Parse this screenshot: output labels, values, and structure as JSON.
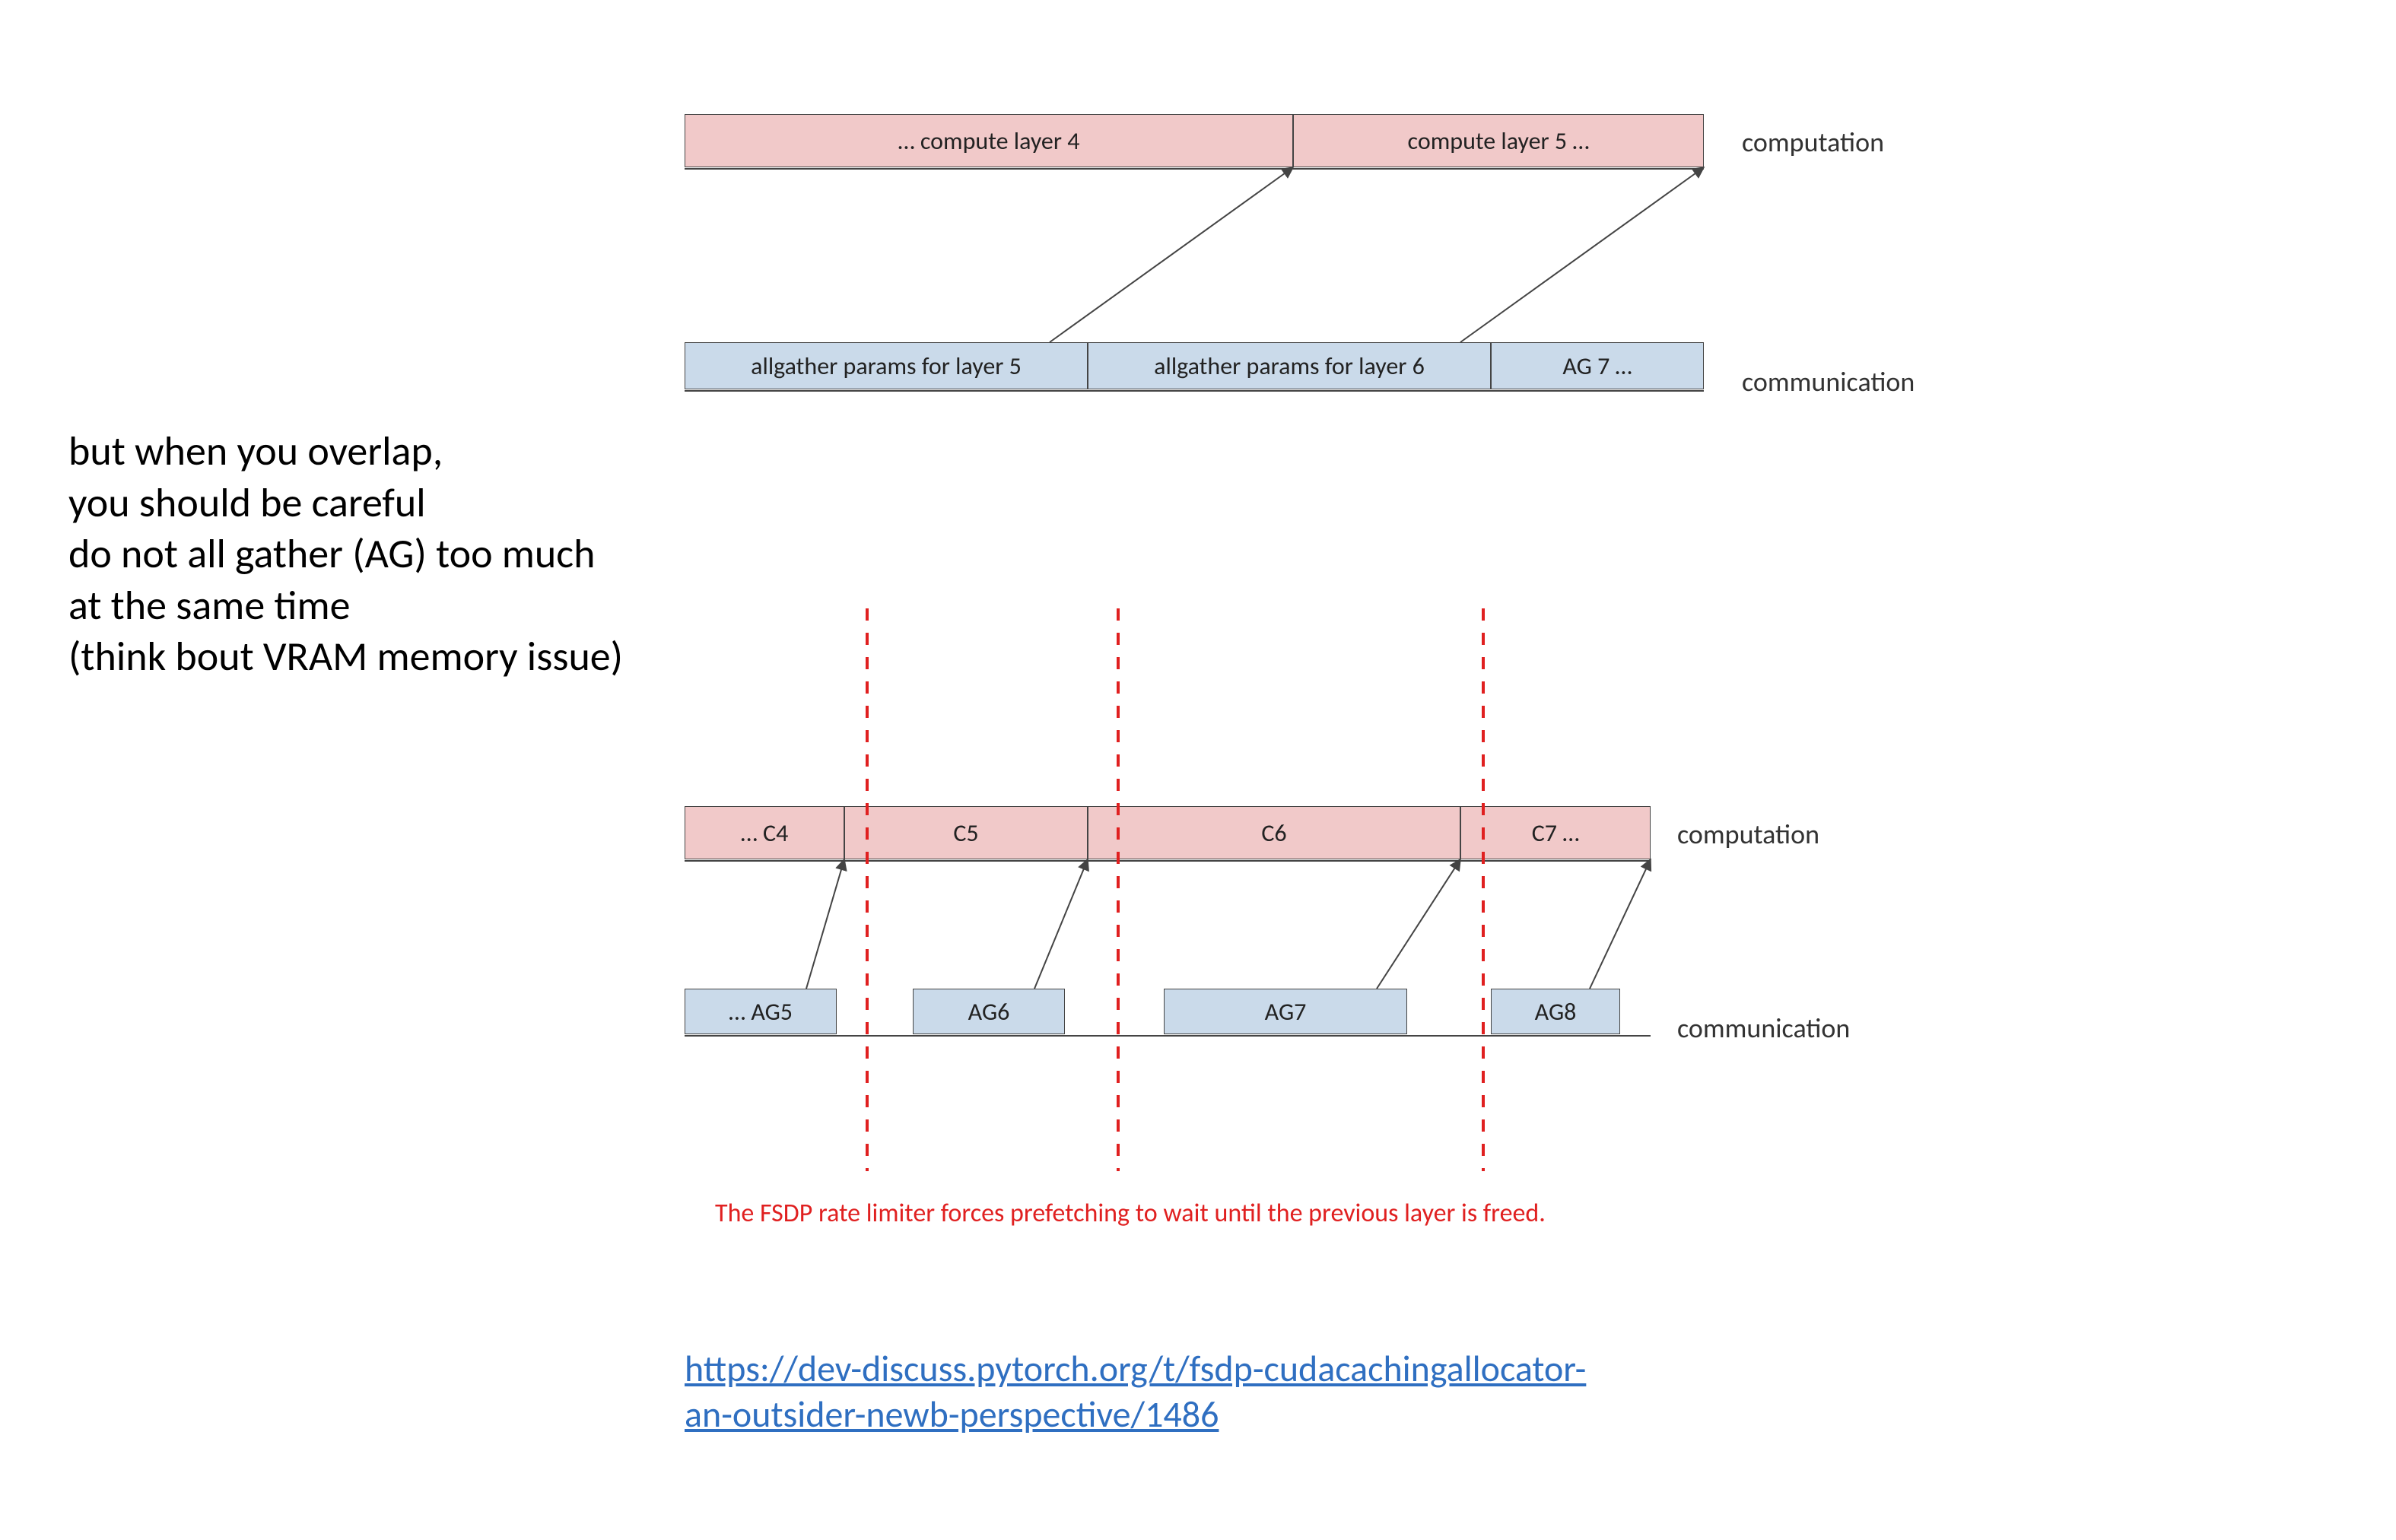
{
  "annotation": {
    "l1": "but when you overlap,",
    "l2": "you should be careful",
    "l3": "do not all gather (AG) too much",
    "l4": "at the same time",
    "l5": "(think bout VRAM memory issue)"
  },
  "diagram1": {
    "compute_row": {
      "items": [
        {
          "label": "… compute layer 4"
        },
        {
          "label": "compute layer 5 …"
        }
      ],
      "lane": "computation"
    },
    "comm_row": {
      "items": [
        {
          "label": "allgather params for layer 5"
        },
        {
          "label": "allgather params for layer 6"
        },
        {
          "label": "AG 7 …"
        }
      ],
      "lane": "communication"
    }
  },
  "diagram2": {
    "compute_row": {
      "items": [
        {
          "label": "… C4"
        },
        {
          "label": "C5"
        },
        {
          "label": "C6"
        },
        {
          "label": "C7 …"
        }
      ],
      "lane": "computation"
    },
    "comm_row": {
      "items": [
        {
          "label": "… AG5"
        },
        {
          "label": "AG6"
        },
        {
          "label": "AG7"
        },
        {
          "label": "AG8"
        }
      ],
      "lane": "communication"
    },
    "caption": "The FSDP rate limiter forces prefetching to wait until the previous layer is freed."
  },
  "link": {
    "l1": "https://dev-discuss.pytorch.org/t/fsdp-cudacachingallocator-",
    "l2": "an-outsider-newb-perspective/1486"
  }
}
